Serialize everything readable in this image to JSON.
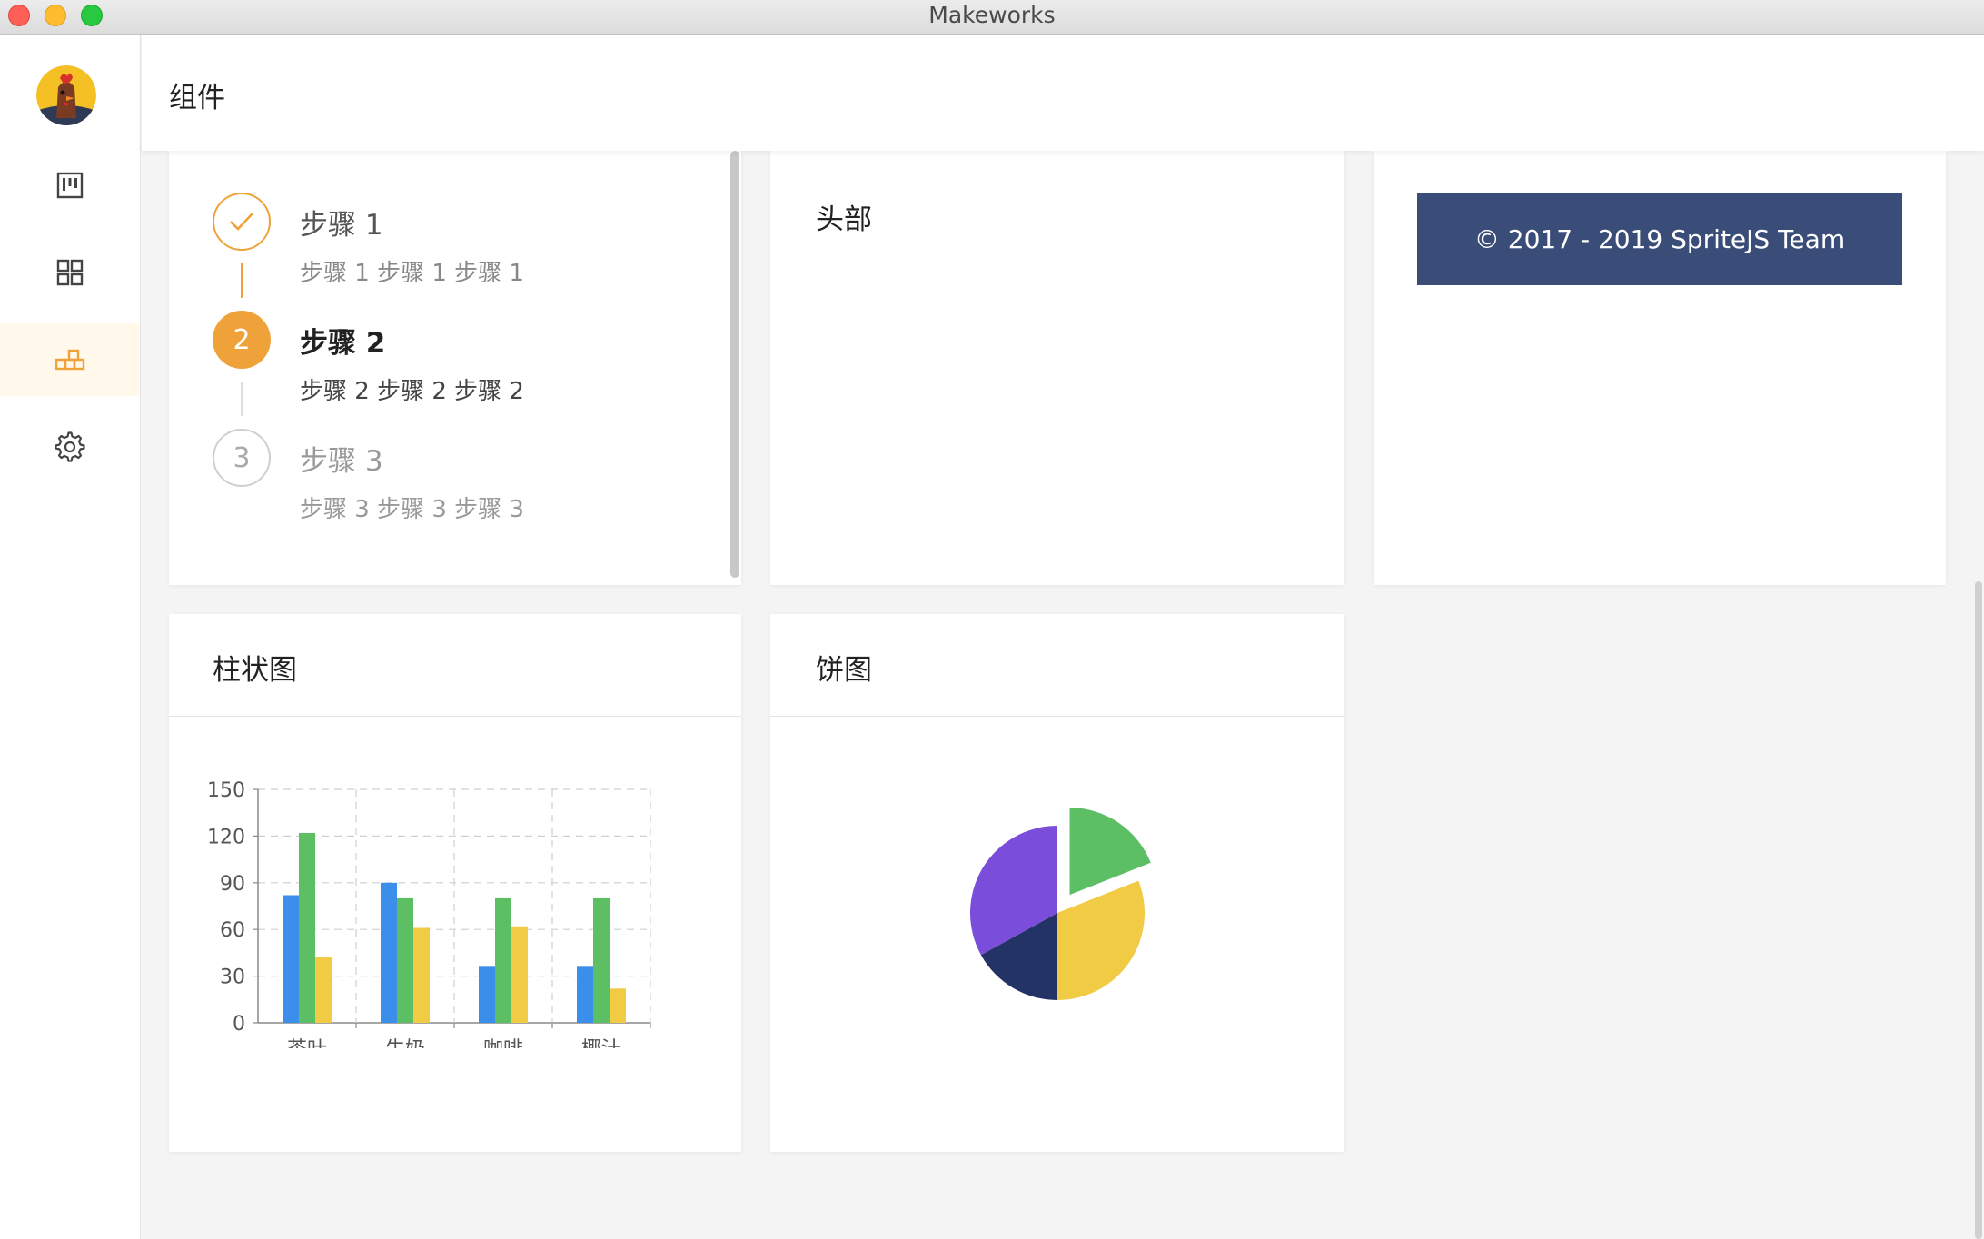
{
  "window": {
    "title": "Makeworks"
  },
  "header": {
    "title": "组件"
  },
  "sidebar": {
    "items": [
      {
        "icon": "board-icon",
        "active": false
      },
      {
        "icon": "grid-icon",
        "active": false
      },
      {
        "icon": "components-icon",
        "active": true
      },
      {
        "icon": "gear-icon",
        "active": false
      }
    ]
  },
  "steps": [
    {
      "number": "1",
      "title": "步骤 1",
      "desc": "步骤 1 步骤 1 步骤 1",
      "status": "done"
    },
    {
      "number": "2",
      "title": "步骤 2",
      "desc": "步骤 2 步骤 2 步骤 2",
      "status": "current"
    },
    {
      "number": "3",
      "title": "步骤 3",
      "desc": "步骤 3 步骤 3 步骤 3",
      "status": "pending"
    }
  ],
  "header_card": {
    "title": "头部"
  },
  "footer_card": {
    "text": "© 2017 - 2019 SpriteJS Team"
  },
  "bar_card": {
    "title": "柱状图"
  },
  "pie_card": {
    "title": "饼图"
  },
  "colors": {
    "accent": "#f0a23a",
    "blue": "#3b8eea",
    "green": "#5dbf64",
    "yellow": "#f2cb45",
    "navy": "#243366",
    "purple": "#7b4ddb",
    "footer_bg": "#3a4d78"
  },
  "chart_data": [
    {
      "type": "bar",
      "categories": [
        "茶叶",
        "牛奶",
        "咖啡",
        "椰汁"
      ],
      "series": [
        {
          "values": [
            82,
            90,
            36,
            36
          ],
          "color": "#3b8eea"
        },
        {
          "values": [
            122,
            80,
            80,
            80
          ],
          "color": "#5dbf64"
        },
        {
          "values": [
            42,
            61,
            62,
            22
          ],
          "color": "#f2cb45"
        }
      ],
      "yticks": [
        "0",
        "30",
        "60",
        "90",
        "120",
        "150"
      ],
      "ylim": [
        0,
        150
      ],
      "grid": true
    },
    {
      "type": "pie",
      "slices": [
        {
          "value": 19,
          "color": "#5dbf64",
          "exploded": true
        },
        {
          "value": 31,
          "color": "#f2cb45",
          "exploded": false
        },
        {
          "value": 17,
          "color": "#243366",
          "exploded": false
        },
        {
          "value": 33,
          "color": "#7b4ddb",
          "exploded": false
        }
      ]
    }
  ]
}
